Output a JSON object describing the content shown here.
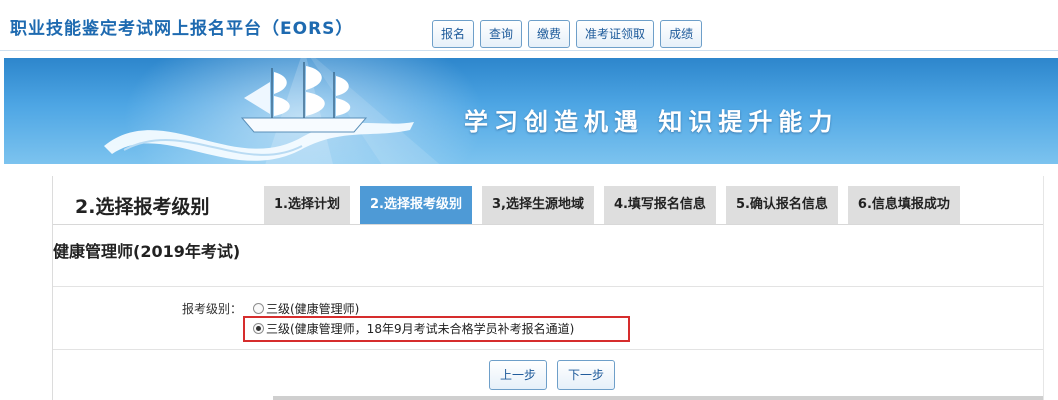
{
  "header": {
    "title": "职业技能鉴定考试网上报名平台（EORS）",
    "nav": [
      "报名",
      "查询",
      "缴费",
      "准考证领取",
      "成绩"
    ]
  },
  "banner": {
    "slogan": "学习创造机遇  知识提升能力",
    "icon": "sailing-ship-icon"
  },
  "page": {
    "step_heading": "2.选择报考级别",
    "steps": [
      {
        "label": "1.选择计划",
        "active": false
      },
      {
        "label": "2.选择报考级别",
        "active": true
      },
      {
        "label": "3,选择生源地域",
        "active": false
      },
      {
        "label": "4.填写报名信息",
        "active": false
      },
      {
        "label": "5.确认报名信息",
        "active": false
      },
      {
        "label": "6.信息填报成功",
        "active": false
      }
    ],
    "exam_title": "健康管理师(2019年考试)",
    "level_label": "报考级别：",
    "options": [
      {
        "label": "三级(健康管理师)",
        "checked": false
      },
      {
        "label": "三级(健康管理师，18年9月考试未合格学员补考报名通道)",
        "checked": true
      }
    ],
    "prev_button": "上一步",
    "next_button": "下一步"
  },
  "colors": {
    "accent": "#1e6ab0",
    "active_step": "#4e9ad6",
    "highlight": "#d62d2d"
  }
}
